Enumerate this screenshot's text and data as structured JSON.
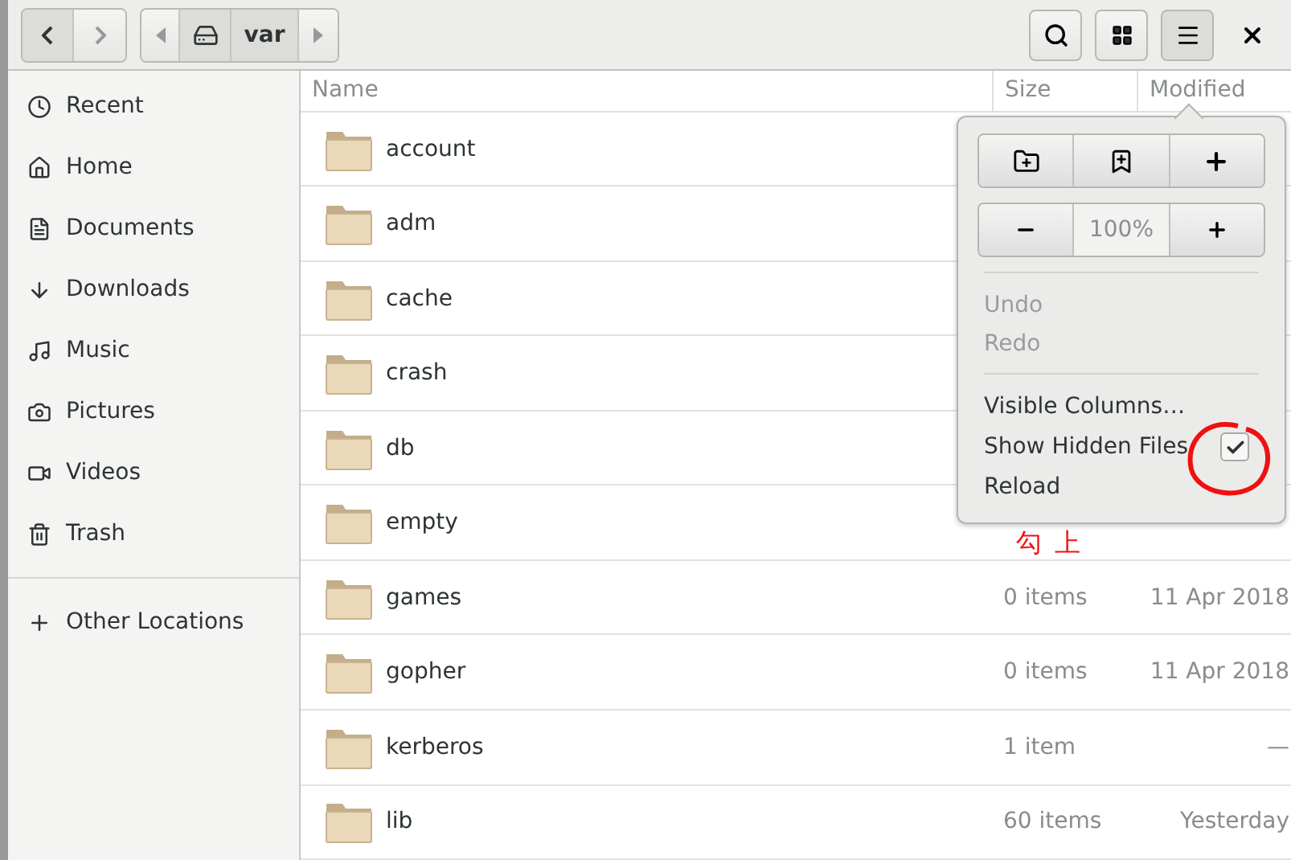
{
  "headerbar": {
    "path": [
      {
        "kind": "disk"
      },
      {
        "kind": "text",
        "label": "var",
        "selected": true
      }
    ]
  },
  "sidebar": {
    "items": [
      {
        "label": "Recent"
      },
      {
        "label": "Home"
      },
      {
        "label": "Documents"
      },
      {
        "label": "Downloads"
      },
      {
        "label": "Music"
      },
      {
        "label": "Pictures"
      },
      {
        "label": "Videos"
      },
      {
        "label": "Trash"
      }
    ],
    "other": {
      "label": "Other Locations"
    }
  },
  "table": {
    "columns": [
      "Name",
      "Size",
      "Modified"
    ],
    "rows": [
      {
        "name": "account"
      },
      {
        "name": "adm"
      },
      {
        "name": "cache"
      },
      {
        "name": "crash"
      },
      {
        "name": "db"
      },
      {
        "name": "empty"
      },
      {
        "name": "games",
        "size": "0 items",
        "modified": "11 Apr 2018"
      },
      {
        "name": "gopher",
        "size": "0 items",
        "modified": "11 Apr 2018"
      },
      {
        "name": "kerberos",
        "size": "1 item",
        "modified": "—"
      },
      {
        "name": "lib",
        "size": "60 items",
        "modified": "Yesterday"
      }
    ]
  },
  "menu": {
    "zoom": "100%",
    "items": [
      {
        "label": "Undo",
        "disabled": true,
        "kind": "plain"
      },
      {
        "label": "Redo",
        "disabled": true,
        "kind": "plain"
      },
      {
        "kind": "separator"
      },
      {
        "label": "Visible Columns…",
        "disabled": false,
        "kind": "plain"
      },
      {
        "label": "Show Hidden Files",
        "disabled": false,
        "kind": "check",
        "checked": true
      },
      {
        "label": "Reload",
        "disabled": false,
        "kind": "plain"
      }
    ]
  },
  "annotation": {
    "note": "勾上"
  }
}
